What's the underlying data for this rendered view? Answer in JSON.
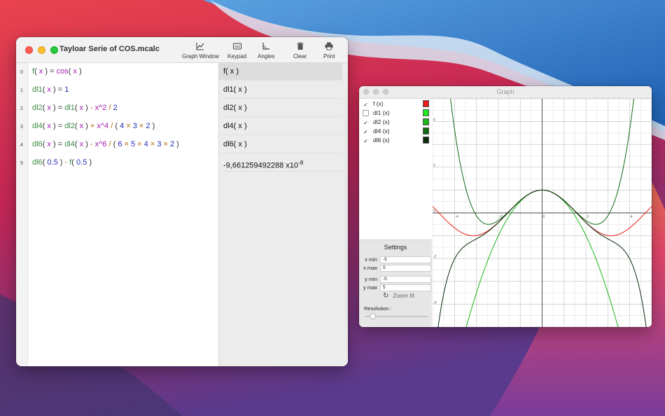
{
  "main_window": {
    "title": "Tayloar Serie of COS.mcalc",
    "toolbar": [
      {
        "label": "Graph Window",
        "icon": "graph-icon"
      },
      {
        "label": "Keypad",
        "icon": "keypad-icon"
      },
      {
        "label": "Angles",
        "icon": "angle-icon"
      },
      {
        "label": "Clear",
        "icon": "trash-icon"
      },
      {
        "label": "Print",
        "icon": "printer-icon"
      }
    ],
    "line_numbers": [
      "0",
      "1",
      "2",
      "3",
      "4",
      "5"
    ],
    "code_lines": [
      [
        {
          "t": "f",
          "c": "cg"
        },
        {
          "t": "( ",
          "c": "ck"
        },
        {
          "t": "x",
          "c": "cp"
        },
        {
          "t": " ) = ",
          "c": "ck"
        },
        {
          "t": "cos",
          "c": "cp"
        },
        {
          "t": "( ",
          "c": "ck"
        },
        {
          "t": "x",
          "c": "cp"
        },
        {
          "t": " )",
          "c": "ck"
        }
      ],
      [
        {
          "t": "dl1",
          "c": "cg"
        },
        {
          "t": "( ",
          "c": "ck"
        },
        {
          "t": "x",
          "c": "cp"
        },
        {
          "t": " ) = ",
          "c": "ck"
        },
        {
          "t": "1",
          "c": "cb"
        }
      ],
      [
        {
          "t": "dl2",
          "c": "cg"
        },
        {
          "t": "( ",
          "c": "ck"
        },
        {
          "t": "x",
          "c": "cp"
        },
        {
          "t": " ) = ",
          "c": "ck"
        },
        {
          "t": "dl1",
          "c": "cg"
        },
        {
          "t": "( ",
          "c": "ck"
        },
        {
          "t": "x",
          "c": "cp"
        },
        {
          "t": " ) ",
          "c": "ck"
        },
        {
          "t": "-",
          "c": "co"
        },
        {
          "t": " x^2 ",
          "c": "cp"
        },
        {
          "t": "/",
          "c": "co"
        },
        {
          "t": " 2",
          "c": "cb"
        }
      ],
      [
        {
          "t": "dl4",
          "c": "cg"
        },
        {
          "t": "( ",
          "c": "ck"
        },
        {
          "t": "x",
          "c": "cp"
        },
        {
          "t": " ) = ",
          "c": "ck"
        },
        {
          "t": "dl2",
          "c": "cg"
        },
        {
          "t": "( ",
          "c": "ck"
        },
        {
          "t": "x",
          "c": "cp"
        },
        {
          "t": " ) ",
          "c": "ck"
        },
        {
          "t": " + ",
          "c": "co"
        },
        {
          "t": " x^4 ",
          "c": "cp"
        },
        {
          "t": "/",
          "c": "co"
        },
        {
          "t": " ( ",
          "c": "ck"
        },
        {
          "t": "4",
          "c": "cb"
        },
        {
          "t": " × ",
          "c": "co"
        },
        {
          "t": "3",
          "c": "cb"
        },
        {
          "t": " × ",
          "c": "co"
        },
        {
          "t": "2",
          "c": "cb"
        },
        {
          "t": " )",
          "c": "ck"
        }
      ],
      [
        {
          "t": "dl6",
          "c": "cg"
        },
        {
          "t": "( ",
          "c": "ck"
        },
        {
          "t": "x",
          "c": "cp"
        },
        {
          "t": " ) = ",
          "c": "ck"
        },
        {
          "t": "dl4",
          "c": "cg"
        },
        {
          "t": "( ",
          "c": "ck"
        },
        {
          "t": "x",
          "c": "cp"
        },
        {
          "t": " ) ",
          "c": "ck"
        },
        {
          "t": "-",
          "c": "co"
        },
        {
          "t": " x^6 ",
          "c": "cp"
        },
        {
          "t": "/",
          "c": "co"
        },
        {
          "t": " ( ",
          "c": "ck"
        },
        {
          "t": "6",
          "c": "cb"
        },
        {
          "t": " × ",
          "c": "co"
        },
        {
          "t": "5",
          "c": "cb"
        },
        {
          "t": " × ",
          "c": "co"
        },
        {
          "t": "4",
          "c": "cb"
        },
        {
          "t": " × ",
          "c": "co"
        },
        {
          "t": "3",
          "c": "cb"
        },
        {
          "t": " × ",
          "c": "co"
        },
        {
          "t": "2",
          "c": "cb"
        },
        {
          "t": " )",
          "c": "ck"
        }
      ],
      [
        {
          "t": "dl6",
          "c": "cg"
        },
        {
          "t": "( ",
          "c": "ck"
        },
        {
          "t": "0.5",
          "c": "cb"
        },
        {
          "t": " ) ",
          "c": "ck"
        },
        {
          "t": "-",
          "c": "co"
        },
        {
          "t": " f",
          "c": "cg"
        },
        {
          "t": "( ",
          "c": "ck"
        },
        {
          "t": "0.5",
          "c": "cb"
        },
        {
          "t": " )",
          "c": "ck"
        }
      ]
    ],
    "results": [
      "f( x )",
      "dl1( x )",
      "dl2( x )",
      "dl4( x )",
      "dl6( x )",
      "-9,661259492288 x10"
    ],
    "result_exponent": "-8"
  },
  "graph_window": {
    "title": "Graph",
    "functions": [
      {
        "label": "f (x)",
        "checked": true,
        "color": "#e81c1c"
      },
      {
        "label": "dl1 (x)",
        "checked": false,
        "color": "#22e822"
      },
      {
        "label": "dl2 (x)",
        "checked": true,
        "color": "#19b619"
      },
      {
        "label": "dl4 (x)",
        "checked": true,
        "color": "#116a11"
      },
      {
        "label": "dl6 (x)",
        "checked": true,
        "color": "#0b2a0b"
      }
    ],
    "settings": {
      "title": "Settings",
      "x_min_label": "x min",
      "x_min": "-5",
      "x_max_label": "x max",
      "x_max": "5",
      "y_min_label": "y min",
      "y_min": "-5",
      "y_max_label": "y max",
      "y_max": "5",
      "zoom_fit": "Zoom fit",
      "resolution_label": "Resolution :",
      "resolution_level": 0.12
    },
    "plot": {
      "x_ticks": [
        "-4",
        "-2",
        "0",
        "2",
        "4"
      ],
      "y_ticks": [
        "4",
        "2",
        "0",
        "-2",
        "-4"
      ]
    }
  }
}
